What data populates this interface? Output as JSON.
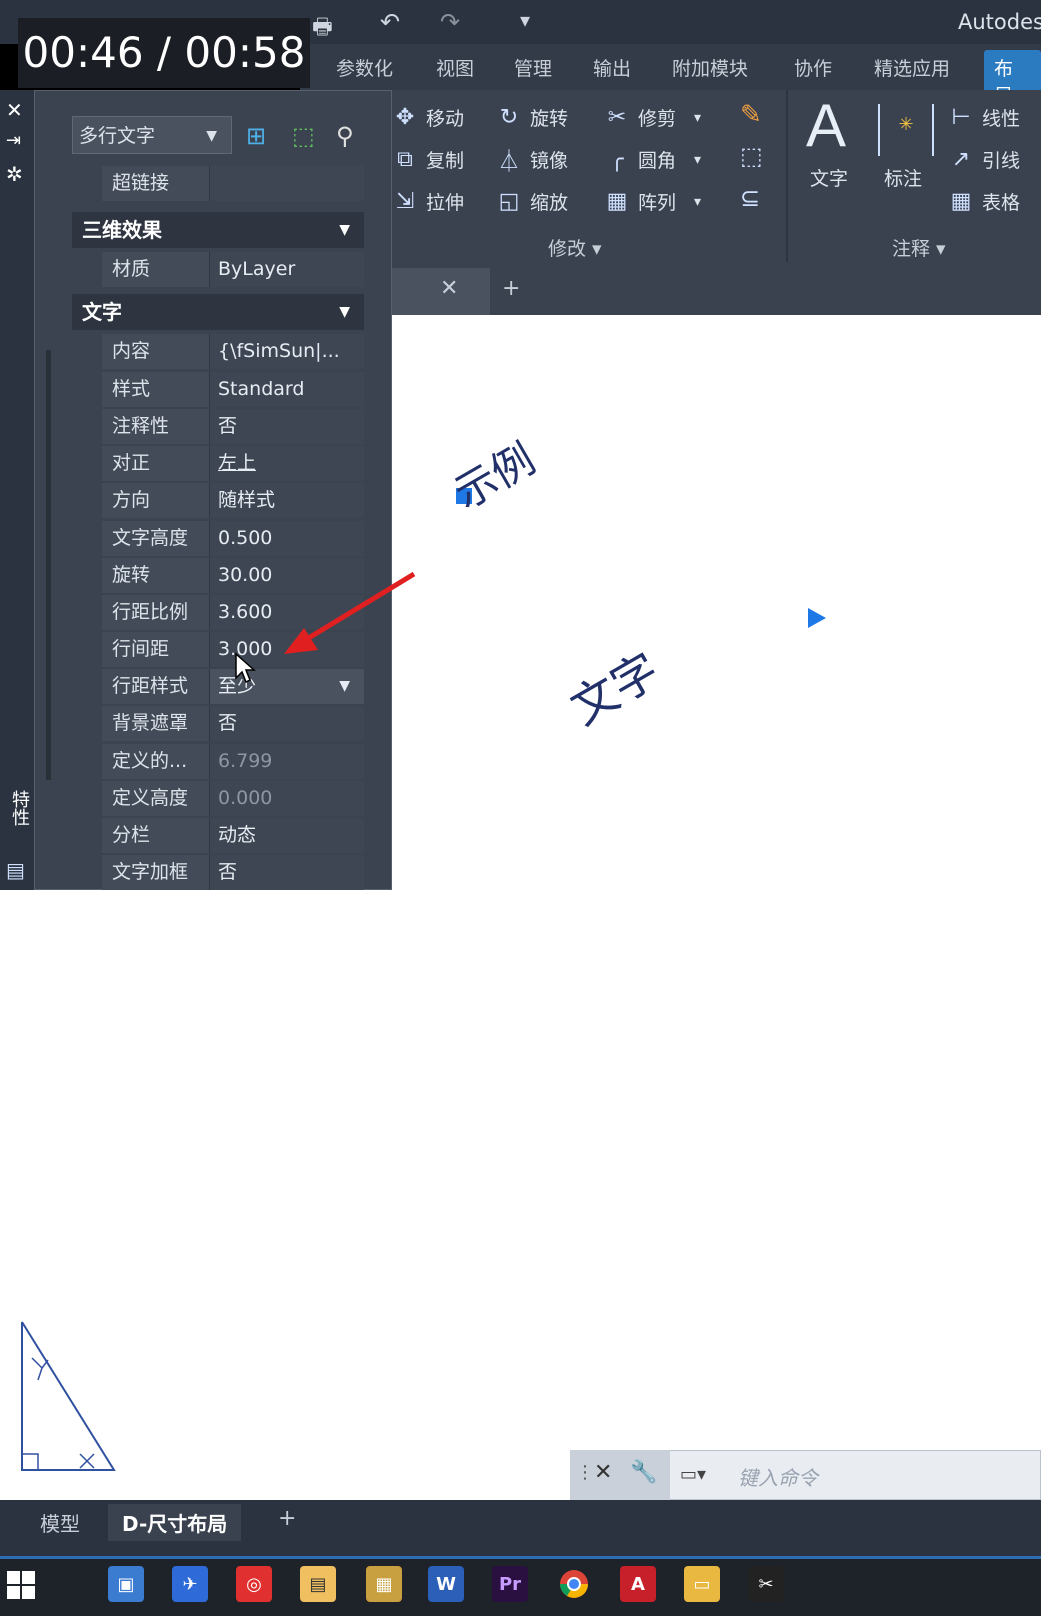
{
  "app": {
    "title_fragment": "Autodes",
    "timer": "00:46 / 00:58"
  },
  "ribbon_tabs": [
    "参数化",
    "视图",
    "管理",
    "输出",
    "附加模块",
    "协作",
    "精选应用",
    "布局"
  ],
  "ribbon": {
    "modify": {
      "items": [
        {
          "icon": "move-icon",
          "label": "移动"
        },
        {
          "icon": "rotate-icon",
          "label": "旋转"
        },
        {
          "icon": "trim-icon",
          "label": "修剪"
        },
        {
          "icon": "copy-icon",
          "label": "复制"
        },
        {
          "icon": "mirror-icon",
          "label": "镜像"
        },
        {
          "icon": "fillet-icon",
          "label": "圆角"
        },
        {
          "icon": "stretch-icon",
          "label": "拉伸"
        },
        {
          "icon": "scale-icon",
          "label": "缩放"
        },
        {
          "icon": "array-icon",
          "label": "阵列"
        }
      ],
      "group_label": "修改"
    },
    "annotation": {
      "text_label": "文字",
      "dim_label": "标注",
      "linear_label": "线性",
      "leader_label": "引线",
      "table_label": "表格",
      "group_label": "注释"
    }
  },
  "palette": {
    "object_type": "多行文字",
    "hyperlink": {
      "key": "超链接",
      "value": ""
    },
    "section_3d": "三维效果",
    "material": {
      "key": "材质",
      "value": "ByLayer"
    },
    "section_text": "文字",
    "props": [
      {
        "key": "内容",
        "value": "{\\fSimSun|..."
      },
      {
        "key": "样式",
        "value": "Standard"
      },
      {
        "key": "注释性",
        "value": "否"
      },
      {
        "key": "对正",
        "value": "左上"
      },
      {
        "key": "方向",
        "value": "随样式"
      },
      {
        "key": "文字高度",
        "value": "0.500"
      },
      {
        "key": "旋转",
        "value": "30.00"
      },
      {
        "key": "行距比例",
        "value": "3.600"
      },
      {
        "key": "行间距",
        "value": "3.000"
      },
      {
        "key": "行距样式",
        "value": "至少"
      },
      {
        "key": "背景遮罩",
        "value": "否"
      },
      {
        "key": "定义的...",
        "value": "6.799"
      },
      {
        "key": "定义高度",
        "value": "0.000"
      },
      {
        "key": "分栏",
        "value": "动态"
      },
      {
        "key": "文字加框",
        "value": "否"
      }
    ],
    "side_label": "特性"
  },
  "canvas": {
    "text_line1": "示例",
    "text_line2": "文字"
  },
  "command": {
    "placeholder": "键入命令"
  },
  "layout_tabs": [
    "模型",
    "D-尺寸布局"
  ],
  "colors": {
    "accent": "#2b7bc0",
    "arrow": "#e02020",
    "grip": "#1e78e6"
  }
}
